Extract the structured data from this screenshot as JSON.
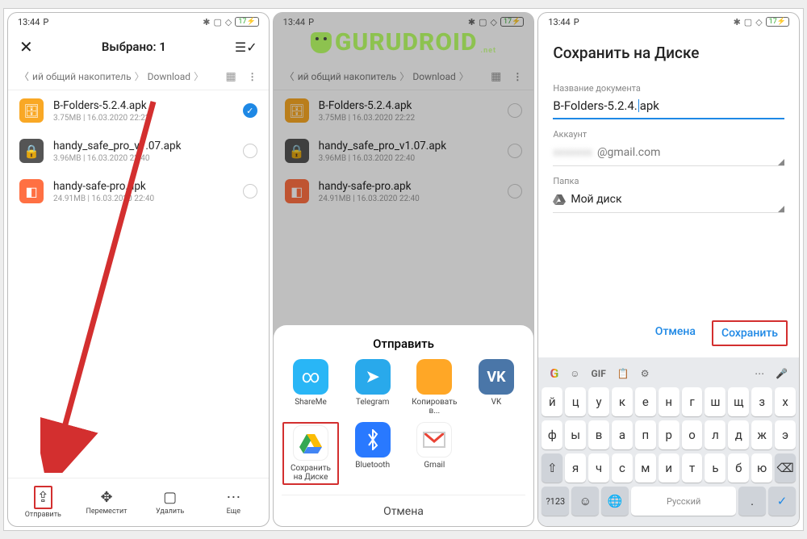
{
  "statusbar": {
    "time": "13:44",
    "sim": "P",
    "battery": "17"
  },
  "watermark": {
    "text": "GURUDROID",
    "suffix": ".net"
  },
  "screen1": {
    "title": "Выбрано: 1",
    "breadcrumb": {
      "path1": "ий общий накопитель",
      "path2": "Download"
    },
    "files": [
      {
        "name": "B-Folders-5.2.4.apk",
        "meta": "3.75MB | 16.03.2020 22:22",
        "checked": true,
        "icon": "orange"
      },
      {
        "name": "handy_safe_pro_v1.07.apk",
        "meta": "3.96MB | 16.03.2020 22:40",
        "checked": false,
        "icon": "gray"
      },
      {
        "name": "handy-safe-pro.apk",
        "meta": "24.91MB | 16.03.2020 22:40",
        "checked": false,
        "icon": "org2"
      }
    ],
    "bottom": {
      "send": "Отправить",
      "move": "Переместит",
      "delete": "Удалить",
      "more": "Еще"
    }
  },
  "screen2": {
    "share_title": "Отправить",
    "apps": [
      {
        "label": "ShareMe",
        "cls": "sblue1",
        "glyph": "∞"
      },
      {
        "label": "Telegram",
        "cls": "sblue2",
        "glyph": "➤"
      },
      {
        "label": "Копировать в...",
        "cls": "sorng",
        "glyph": ""
      },
      {
        "label": "VK",
        "cls": "svk",
        "glyph": "VK"
      },
      {
        "label": "Сохранить на Диске",
        "cls": "sdrive",
        "glyph": "drive"
      },
      {
        "label": "Bluetooth",
        "cls": "sbt",
        "glyph": "⁂"
      },
      {
        "label": "Gmail",
        "cls": "sgm",
        "glyph": "M"
      }
    ],
    "cancel": "Отмена"
  },
  "screen3": {
    "title": "Сохранить на Диске",
    "doc_label": "Название документа",
    "doc_value_a": "B-Folders-5.2.4.",
    "doc_value_b": "apk",
    "acc_label": "Аккаунт",
    "acc_value": "@gmail.com",
    "folder_label": "Папка",
    "folder_value": "Мой диск",
    "cancel": "Отмена",
    "save": "Сохранить",
    "keyboard": {
      "row1": [
        "й",
        "ц",
        "у",
        "к",
        "е",
        "н",
        "г",
        "ш",
        "щ",
        "з",
        "х"
      ],
      "row2": [
        "ф",
        "ы",
        "в",
        "а",
        "п",
        "р",
        "о",
        "л",
        "д",
        "ж",
        "э"
      ],
      "row3": [
        "я",
        "ч",
        "с",
        "м",
        "и",
        "т",
        "ь",
        "б",
        "ю"
      ],
      "shift": "⇧",
      "back": "⌫",
      "num": "?123",
      "space": "Русский",
      "gif": "GIF"
    }
  }
}
